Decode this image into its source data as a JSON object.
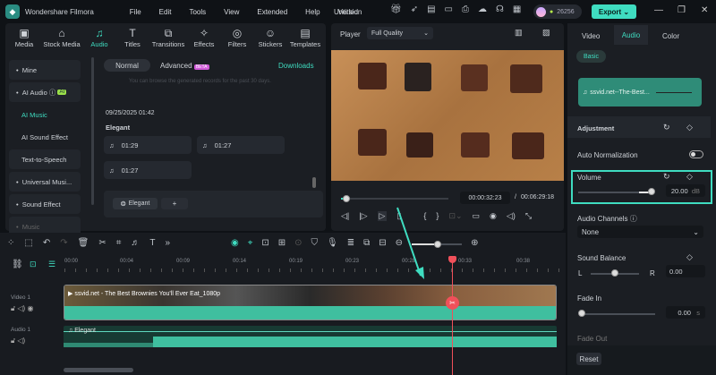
{
  "app": {
    "name": "Wondershare Filmora",
    "menu": [
      "File",
      "Edit",
      "Tools",
      "View",
      "Extended",
      "Help",
      "Version"
    ],
    "project": "Untitled",
    "credits": "26256",
    "export": "Export"
  },
  "toolbar": [
    "Media",
    "Stock Media",
    "Audio",
    "Titles",
    "Transitions",
    "Effects",
    "Filters",
    "Stickers",
    "Templates"
  ],
  "sidebar": [
    "Mine",
    "AI Audio",
    "AI Music",
    "AI Sound Effect",
    "Text-to-Speech",
    "Universal Musi...",
    "Sound Effect",
    "Music"
  ],
  "ai_badge": "AI",
  "content": {
    "tab_normal": "Normal",
    "tab_advanced": "Advanced",
    "beta": "BETA",
    "downloads": "Downloads",
    "note": "You can browse the generated records for the past 30 days.",
    "date": "09/25/2025 01:42",
    "group": "Elegant",
    "tracks": [
      "01:29",
      "01:27",
      "01:27"
    ],
    "tag": "Elegant",
    "add": "+"
  },
  "player": {
    "label": "Player",
    "quality": "Full Quality",
    "current": "00:00:32:23",
    "total": "00:06:29:18",
    "sep": "/",
    "progress": 0.05
  },
  "right": {
    "tabs": [
      "Video",
      "Audio",
      "Color"
    ],
    "basic": "Basic",
    "clip": "ssvid.net--The-Best...",
    "adjustment": "Adjustment",
    "auto_norm": "Auto Normalization",
    "volume": "Volume",
    "volume_value": "20.00",
    "volume_unit": "dB",
    "channels": "Audio Channels",
    "channels_value": "None",
    "balance": "Sound Balance",
    "L": "L",
    "R": "R",
    "balance_value": "0.00",
    "fade_in": "Fade In",
    "fade_in_value": "0.00",
    "fade_unit": "s",
    "fade_out": "Fade Out",
    "reset": "Reset"
  },
  "timeline": {
    "ruler": [
      "00:00",
      "00:04",
      "00:09",
      "00:14",
      "00:19",
      "00:23",
      "00:28",
      "00:33",
      "00:38"
    ],
    "video_track": "Video 1",
    "audio_track": "Audio 1",
    "video_clip": "ssvid.net - The Best Brownies You'll Ever Eat_1080p",
    "audio_clip": "Elegant"
  },
  "colors": {
    "accent": "#3fdcc0",
    "playhead": "#f0505a",
    "bg": "#0f1216"
  }
}
